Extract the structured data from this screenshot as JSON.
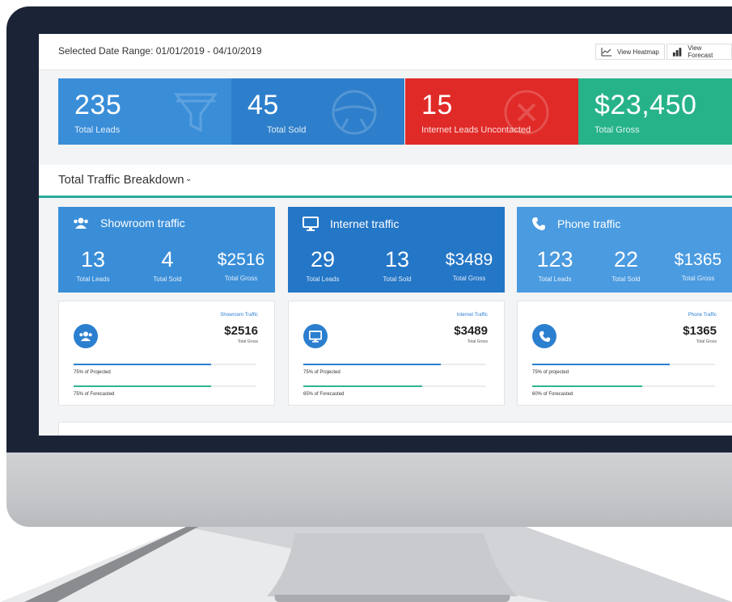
{
  "header": {
    "date_range": "Selected Date Range: 01/01/2019 - 04/10/2019",
    "heatmap_label": "View Heatmap",
    "forecast_label": "View Forecast"
  },
  "kpis": [
    {
      "value": "235",
      "label": "Total Leads",
      "color": "#3a8ed8",
      "icon": "funnel-icon"
    },
    {
      "value": "45",
      "label": "Total Sold",
      "color": "#2e7fcb",
      "icon": "steering-wheel-icon"
    },
    {
      "value": "15",
      "label": "Internet Leads Uncontacted",
      "color": "#e02a27",
      "icon": "x-circle-icon"
    },
    {
      "value": "$23,450",
      "label": "Total Gross",
      "color": "#27b38a",
      "icon": "dollar-icon"
    }
  ],
  "section": {
    "title": "Total Traffic Breakdown",
    "chevron": "⌄"
  },
  "traffic": [
    {
      "name": "Showroom traffic",
      "icon": "people-icon",
      "color": "#3a8ed8",
      "leads": "13",
      "sold": "4",
      "gross": "$2516",
      "leads_label": "Total Leads",
      "sold_label": "Total Sold",
      "gross_label": "Total Gross"
    },
    {
      "name": "Internet traffic",
      "icon": "monitor-icon",
      "color": "#2476c6",
      "leads": "29",
      "sold": "13",
      "gross": "$3489",
      "leads_label": "Total Leads",
      "sold_label": "Total Sold",
      "gross_label": "Total Gross"
    },
    {
      "name": "Phone traffic",
      "icon": "phone-icon",
      "color": "#4b9be0",
      "leads": "123",
      "sold": "22",
      "gross": "$1365",
      "leads_label": "Total Leads",
      "sold_label": "Total Sold",
      "gross_label": "Total Gross"
    }
  ],
  "details": [
    {
      "source": "Showroom Traffic",
      "amount": "$2516",
      "gross_label": "Total Gross",
      "projected_label": "75% of Projected",
      "forecasted_label": "75% of Forecasted",
      "projected": 0.75,
      "forecasted": 0.75
    },
    {
      "source": "Internet Traffic",
      "amount": "$3489",
      "gross_label": "Total Gross",
      "projected_label": "75% of Projected",
      "forecasted_label": "65% of Forecasted",
      "projected": 0.75,
      "forecasted": 0.65
    },
    {
      "source": "Phone Traffic",
      "amount": "$1365",
      "gross_label": "Total Gross",
      "projected_label": "75% of projected",
      "forecasted_label": "60% of Forecasted",
      "projected": 0.75,
      "forecasted": 0.6
    }
  ],
  "colors": {
    "projected_bar": "#2b7fcf",
    "forecasted_bar": "#2fb592",
    "accent_teal": "#2aa99a"
  }
}
